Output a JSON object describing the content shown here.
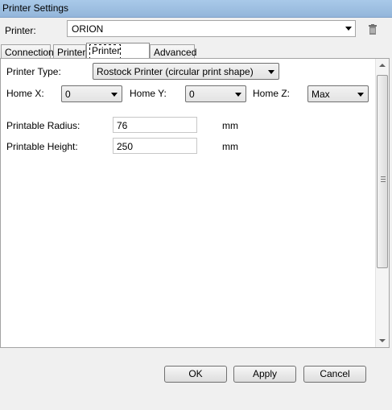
{
  "window": {
    "title": "Printer Settings"
  },
  "printer": {
    "label": "Printer:",
    "selected": "ORION"
  },
  "tabs": [
    {
      "label": "Connection"
    },
    {
      "label": "Printer"
    },
    {
      "label": "Printer Shape"
    },
    {
      "label": "Advanced"
    }
  ],
  "shape": {
    "printer_type_label": "Printer Type:",
    "printer_type_value": "Rostock Printer (circular print shape)",
    "home_x_label": "Home X:",
    "home_x_value": "0",
    "home_y_label": "Home Y:",
    "home_y_value": "0",
    "home_z_label": "Home Z:",
    "home_z_value": "Max",
    "radius_label": "Printable Radius:",
    "radius_value": "76",
    "radius_unit": "mm",
    "height_label": "Printable Height:",
    "height_value": "250",
    "height_unit": "mm"
  },
  "buttons": {
    "ok": "OK",
    "apply": "Apply",
    "cancel": "Cancel"
  },
  "icons": {
    "trash": "trash-icon"
  }
}
